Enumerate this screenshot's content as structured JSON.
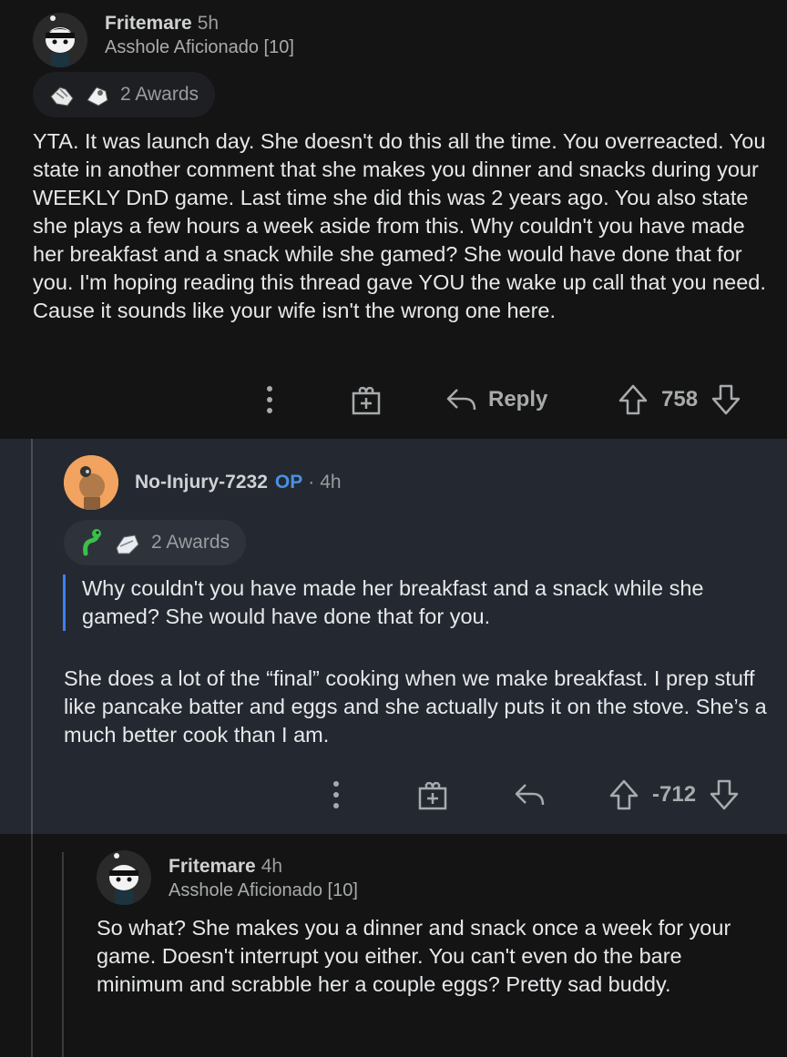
{
  "comments": [
    {
      "username": "Fritemare",
      "time": "5h",
      "flair": "Asshole Aficionado [10]",
      "awards_label": "2 Awards",
      "body": "YTA. It was launch day. She doesn't do this all the time. You overreacted. You state in another comment that she makes you dinner and snacks during your WEEKLY DnD game. Last time she did this was 2 years ago. You also state she plays a few hours a week aside from this. Why couldn't you have made her breakfast and a snack while she gamed? She would have done that for you. I'm hoping reading this thread gave YOU the wake up call that you need. Cause it sounds like your wife isn't the wrong one here.",
      "reply_label": "Reply",
      "score": "758"
    },
    {
      "username": "No-Injury-7232",
      "op_badge": "OP",
      "separator": "·",
      "time": "4h",
      "awards_label": "2 Awards",
      "quote": "Why couldn't you have made her breakfast and a snack while she gamed? She would have done that for you.",
      "body": "She does a lot of the “final” cooking when we make breakfast. I prep stuff like pancake batter and eggs and she actually puts it on the stove. She’s a much better cook than I am.",
      "score": "-712"
    },
    {
      "username": "Fritemare",
      "time": "4h",
      "flair": "Asshole Aficionado [10]",
      "body": "So what? She makes you a dinner and snack once a week for your game. Doesn't interrupt you either. You can't even do the bare minimum and scrabble her a couple eggs? Pretty sad buddy."
    }
  ],
  "colors": {
    "background": "#141414",
    "reply_background": "#242830",
    "op_badge": "#4a90e2",
    "quote_bar": "#3d7ff0"
  }
}
